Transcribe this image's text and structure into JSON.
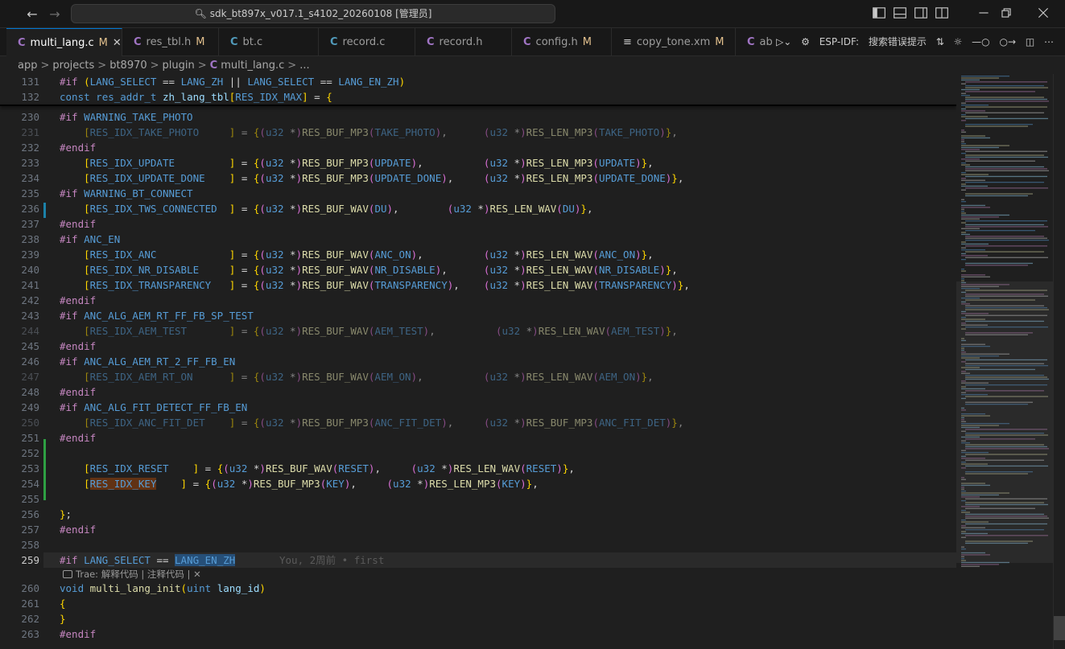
{
  "window": {
    "title": "sdk_bt897x_v017.1_s4102_20260108 [管理员]"
  },
  "tabs": [
    {
      "label": "multi_lang.c",
      "status": "M",
      "kind": "c",
      "active": true
    },
    {
      "label": "res_tbl.h",
      "status": "M",
      "kind": "h",
      "active": false
    },
    {
      "label": "bt.c",
      "status": "",
      "kind": "c",
      "active": false
    },
    {
      "label": "record.c",
      "status": "",
      "kind": "c",
      "active": false
    },
    {
      "label": "record.h",
      "status": "",
      "kind": "c",
      "active": false
    },
    {
      "label": "config.h",
      "status": "M",
      "kind": "c",
      "active": false
    },
    {
      "label": "copy_tone.xm",
      "status": "M",
      "kind": "xml",
      "active": false
    },
    {
      "label": "ab",
      "status": "",
      "kind": "c",
      "active": false
    }
  ],
  "tab_actions": {
    "espidf_label": "ESP-IDF:",
    "search_label": "搜索错误提示"
  },
  "breadcrumb": [
    "app",
    "projects",
    "bt8970",
    "plugin",
    "multi_lang.c",
    "..."
  ],
  "codelens": {
    "text": "Trae: 解释代码 | 注释代码 | ✕"
  },
  "blame": "You, 2周前 • first",
  "lines": [
    {
      "n": "131",
      "text": "#if (LANG_SELECT == LANG_ZH || LANG_SELECT == LANG_EN_ZH)"
    },
    {
      "n": "132",
      "text": "const res_addr_t zh_lang_tbl[RES_IDX_MAX] = {"
    },
    {
      "n": "230",
      "text": "#if WARNING_TAKE_PHOTO"
    },
    {
      "n": "231",
      "text": "    [RES_IDX_TAKE_PHOTO     ] = {(u32 *)RES_BUF_MP3(TAKE_PHOTO),      (u32 *)RES_LEN_MP3(TAKE_PHOTO)},"
    },
    {
      "n": "232",
      "text": "#endif"
    },
    {
      "n": "233",
      "text": "    [RES_IDX_UPDATE         ] = {(u32 *)RES_BUF_MP3(UPDATE),          (u32 *)RES_LEN_MP3(UPDATE)},"
    },
    {
      "n": "234",
      "text": "    [RES_IDX_UPDATE_DONE    ] = {(u32 *)RES_BUF_MP3(UPDATE_DONE),     (u32 *)RES_LEN_MP3(UPDATE_DONE)},"
    },
    {
      "n": "235",
      "text": "#if WARNING_BT_CONNECT"
    },
    {
      "n": "236",
      "text": "    [RES_IDX_TWS_CONNECTED  ] = {(u32 *)RES_BUF_WAV(DU),        (u32 *)RES_LEN_WAV(DU)},"
    },
    {
      "n": "237",
      "text": "#endif"
    },
    {
      "n": "238",
      "text": "#if ANC_EN"
    },
    {
      "n": "239",
      "text": "    [RES_IDX_ANC            ] = {(u32 *)RES_BUF_WAV(ANC_ON),          (u32 *)RES_LEN_WAV(ANC_ON)},"
    },
    {
      "n": "240",
      "text": "    [RES_IDX_NR_DISABLE     ] = {(u32 *)RES_BUF_WAV(NR_DISABLE),      (u32 *)RES_LEN_WAV(NR_DISABLE)},"
    },
    {
      "n": "241",
      "text": "    [RES_IDX_TRANSPARENCY   ] = {(u32 *)RES_BUF_WAV(TRANSPARENCY),    (u32 *)RES_LEN_WAV(TRANSPARENCY)},"
    },
    {
      "n": "242",
      "text": "#endif"
    },
    {
      "n": "243",
      "text": "#if ANC_ALG_AEM_RT_FF_FB_SP_TEST"
    },
    {
      "n": "244",
      "text": "    [RES_IDX_AEM_TEST       ] = {(u32 *)RES_BUF_WAV(AEM_TEST),          (u32 *)RES_LEN_WAV(AEM_TEST)},"
    },
    {
      "n": "245",
      "text": "#endif"
    },
    {
      "n": "246",
      "text": "#if ANC_ALG_AEM_RT_2_FF_FB_EN"
    },
    {
      "n": "247",
      "text": "    [RES_IDX_AEM_RT_ON      ] = {(u32 *)RES_BUF_WAV(AEM_ON),          (u32 *)RES_LEN_WAV(AEM_ON)},"
    },
    {
      "n": "248",
      "text": "#endif"
    },
    {
      "n": "249",
      "text": "#if ANC_ALG_FIT_DETECT_FF_FB_EN"
    },
    {
      "n": "250",
      "text": "    [RES_IDX_ANC_FIT_DET    ] = {(u32 *)RES_BUF_MP3(ANC_FIT_DET),     (u32 *)RES_BUF_MP3(ANC_FIT_DET)},"
    },
    {
      "n": "251",
      "text": "#endif"
    },
    {
      "n": "252",
      "text": ""
    },
    {
      "n": "253",
      "text": "    [RES_IDX_RESET    ] = {(u32 *)RES_BUF_WAV(RESET),     (u32 *)RES_LEN_WAV(RESET)},"
    },
    {
      "n": "254",
      "text": "    [RES_IDX_KEY    ] = {(u32 *)RES_BUF_MP3(KEY),     (u32 *)RES_LEN_MP3(KEY)},"
    },
    {
      "n": "255",
      "text": ""
    },
    {
      "n": "256",
      "text": "};"
    },
    {
      "n": "257",
      "text": "#endif"
    },
    {
      "n": "258",
      "text": ""
    },
    {
      "n": "259",
      "text": "#if LANG_SELECT == LANG_EN_ZH"
    },
    {
      "n": "260",
      "text": "void multi_lang_init(uint lang_id)"
    },
    {
      "n": "261",
      "text": "{"
    },
    {
      "n": "262",
      "text": "}"
    },
    {
      "n": "263",
      "text": "#endif"
    }
  ],
  "colors": {
    "background": "#1f1f1f",
    "titlebar": "#181818",
    "accent": "#0078d4",
    "keyword": "#c586c0",
    "type": "#569cd6",
    "function": "#dcdcaa",
    "identifier": "#9cdcfe",
    "modified": "#e2c08d"
  }
}
